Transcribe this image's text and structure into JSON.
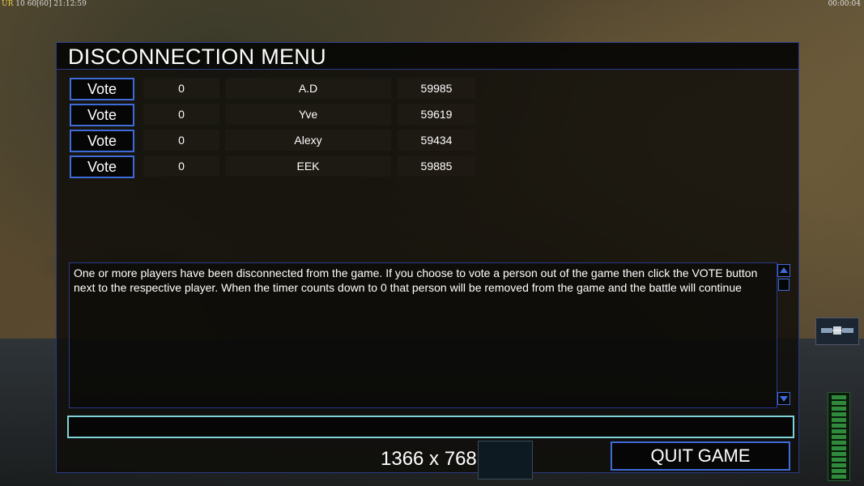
{
  "hud": {
    "top_left_prefix": "UR",
    "top_left_stats": "10 60[60]",
    "top_left_time": "21:12:59",
    "top_right_time": "00:00:04"
  },
  "dialog": {
    "title": "DISCONNECTION MENU",
    "vote_label": "Vote",
    "players": [
      {
        "count": "0",
        "name": "A.D",
        "value": "59985"
      },
      {
        "count": "0",
        "name": "Yve",
        "value": "59619"
      },
      {
        "count": "0",
        "name": "Alexy",
        "value": "59434"
      },
      {
        "count": "0",
        "name": "EEK",
        "value": "59885"
      }
    ],
    "message": "One or more players have been disconnected from the game. If you choose to vote a person out of the game then click the VOTE button next to the respective player. When the timer counts down to 0 that person will be removed from the game and the battle will continue",
    "chat_value": "",
    "quit_label": "QUIT GAME"
  },
  "overlay": {
    "resolution": "1366 x 768"
  },
  "colors": {
    "accent": "#3d6bd8",
    "input_border": "#7fd3d8",
    "power": "#2f8a3b"
  },
  "power_level": 0.95
}
